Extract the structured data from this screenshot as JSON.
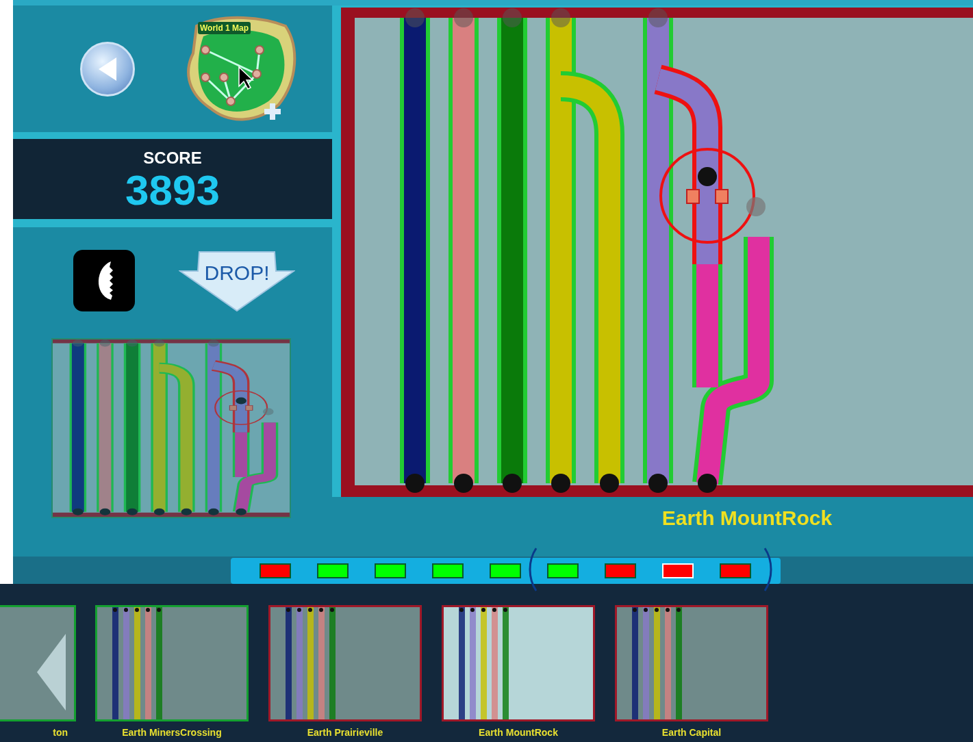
{
  "map": {
    "title": "World 1 Map"
  },
  "score": {
    "label": "SCORE",
    "value": "3893"
  },
  "drop_button": {
    "label": "DROP!"
  },
  "level_title": "Earth MountRock",
  "progress": [
    {
      "color": "#ff0000",
      "selected": false
    },
    {
      "color": "#00ff00",
      "selected": false
    },
    {
      "color": "#00ff00",
      "selected": false
    },
    {
      "color": "#00ff00",
      "selected": false
    },
    {
      "color": "#00ff00",
      "selected": false
    },
    {
      "color": "#00ff00",
      "selected": false
    },
    {
      "color": "#ff0000",
      "selected": false
    },
    {
      "color": "#ff0000",
      "selected": true
    },
    {
      "color": "#ff0000",
      "selected": false
    }
  ],
  "levels": [
    {
      "name": "ton",
      "solved": true,
      "selected": false
    },
    {
      "name": "Earth MinersCrossing",
      "solved": true,
      "selected": false
    },
    {
      "name": "Earth Prairieville",
      "solved": false,
      "selected": false
    },
    {
      "name": "Earth MountRock",
      "solved": false,
      "selected": true
    },
    {
      "name": "Earth Capital",
      "solved": false,
      "selected": false
    }
  ]
}
